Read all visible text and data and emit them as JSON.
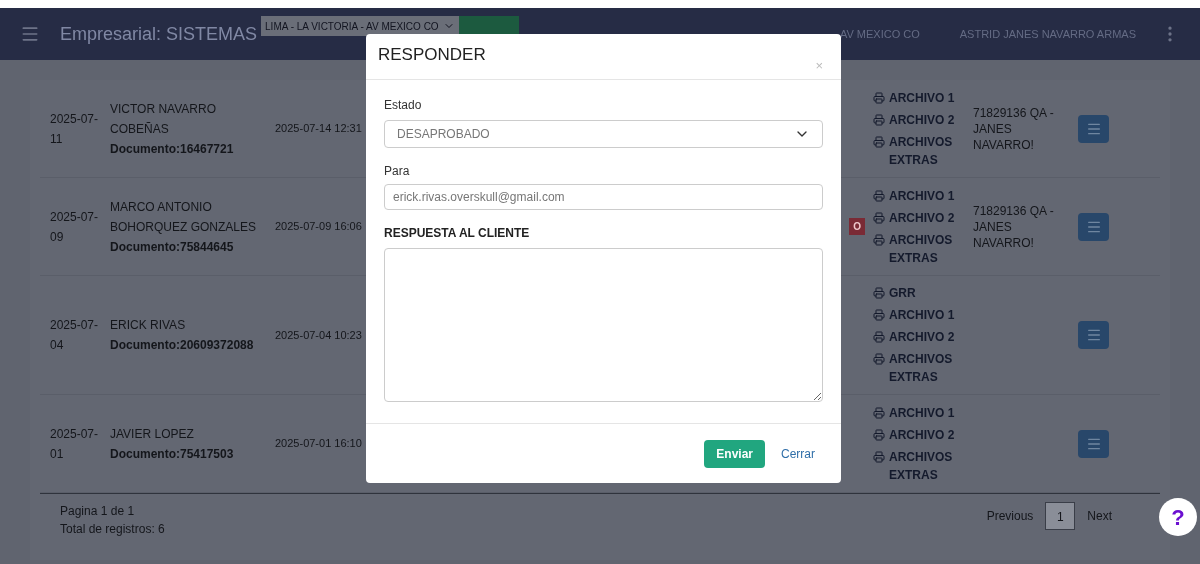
{
  "header": {
    "title": "Empresarial: SISTEMAS",
    "location_select": "LIMA - LA VICTORIA - AV MEXICO CO",
    "location_text": "AV MEXICO CO",
    "user_name": "ASTRID JANES NAVARRO ARMAS"
  },
  "rows": [
    {
      "date": "2025-07-11",
      "name": "VICTOR NAVARRO COBEÑAS",
      "document": "Documento:16467721",
      "datetime": "2025-07-14 12:31",
      "files": [
        "ARCHIVO 1",
        "ARCHIVO 2",
        "ARCHIVOS EXTRAS"
      ],
      "user": "71829136 QA - JANES NAVARRO!"
    },
    {
      "date": "2025-07-09",
      "name": "MARCO ANTONIO BOHORQUEZ GONZALES",
      "document": "Documento:75844645",
      "datetime": "2025-07-09 16:06",
      "badge": "O",
      "files": [
        "ARCHIVO 1",
        "ARCHIVO 2",
        "ARCHIVOS EXTRAS"
      ],
      "user": "71829136 QA - JANES NAVARRO!"
    },
    {
      "date": "2025-07-04",
      "name": "ERICK RIVAS",
      "document": "Documento:20609372088",
      "datetime": "2025-07-04 10:23",
      "files": [
        "GRR",
        "ARCHIVO 1",
        "ARCHIVO 2",
        "ARCHIVOS EXTRAS"
      ]
    },
    {
      "date": "2025-07-01",
      "name": "JAVIER LOPEZ",
      "document": "Documento:75417503",
      "datetime": "2025-07-01 16:10",
      "files": [
        "ARCHIVO 1",
        "ARCHIVO 2",
        "ARCHIVOS EXTRAS"
      ]
    }
  ],
  "footer": {
    "page_info": "Pagina 1 de 1",
    "total": "Total de registros: 6",
    "previous": "Previous",
    "pages": [
      {
        "label": "1",
        "selected": true
      }
    ],
    "next": "Next"
  },
  "modal": {
    "title": "RESPONDER",
    "close": "×",
    "estado": {
      "label": "Estado",
      "value": "DESAPROBADO"
    },
    "para": {
      "label": "Para",
      "value": "erick.rivas.overskull@gmail.com"
    },
    "respuesta": {
      "label": "RESPUESTA AL CLIENTE"
    },
    "buttons": [
      {
        "label": "Enviar",
        "kind": "primary"
      },
      {
        "label": "Cerrar",
        "kind": "link"
      }
    ]
  },
  "help": "?"
}
